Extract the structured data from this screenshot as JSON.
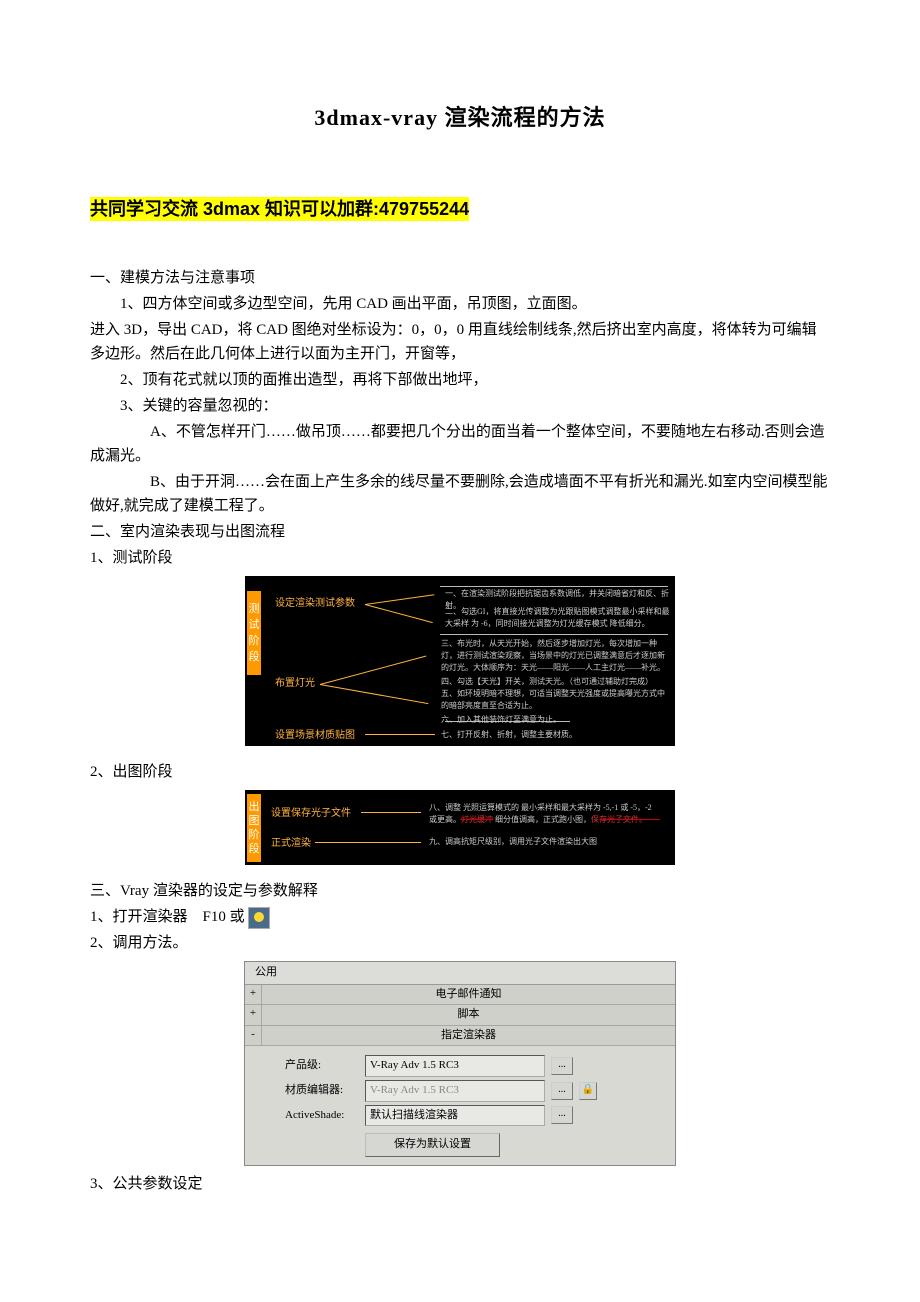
{
  "title": "3dmax-vray 渲染流程的方法",
  "highlight": "共同学习交流 3dmax 知识可以加群:479755244",
  "s1_head": "一、建模方法与注意事项",
  "s1_1": "1、四方体空间或多边型空间，先用 CAD 画出平面，吊顶图，立面图。",
  "s1_body1": "进入 3D，导出 CAD，将 CAD 图绝对坐标设为：0，0，0 用直线绘制线条,然后挤出室内高度，将体转为可编辑多边形。然后在此几何体上进行以面为主开门，开窗等，",
  "s1_2": "2、顶有花式就以顶的面推出造型，再将下部做出地坪，",
  "s1_3": "3、关键的容量忽视的：",
  "s1_3a": "A、不管怎样开门……做吊顶……都要把几个分出的面当着一个整体空间，不要随地左右移动.否则会造成漏光。",
  "s1_3b": "B、由于开洞……会在面上产生多余的线尽量不要删除,会造成墙面不平有折光和漏光.如室内空间模型能做好,就完成了建模工程了。",
  "s2_head": "二、室内渲染表现与出图流程",
  "s2_1": "1、测试阶段",
  "s2_2": "2、出图阶段",
  "s3_head": "三、Vray 渲染器的设定与参数解释",
  "s3_1a": "1、打开渲染器　F10 或",
  "s3_2": "2、调用方法。",
  "s3_3": "3、公共参数设定",
  "diag1": {
    "sidebar": [
      "测",
      "试",
      "阶",
      "段"
    ],
    "left": [
      "设定渲染测试参数",
      "布置灯光",
      "设置场景材质贴图"
    ],
    "right1": "在渲染测试阶段把抗锯齿系数调低，并关闭暗省灯和反、折射。",
    "right2": "勾选GI，将直接光传调整为光跟贴图模式调整最小采样和最大采样 为 -6，同时间接光调整为灯光缓存模式 降低细分。",
    "right3": "布光时，从天光开始，然后逐步增加灯光，每次增加一种灯，进行测试渲染观察，当场景中的灯光已调整满意后才逐加新的灯光。大体顺序为：天光——阳光——人工主灯光——补光。",
    "right4": "勾选【天光】开关，测试天光。（也可通过辅助灯完成）",
    "right5": "如环境明暗不理想，可适当调整天光强度或提高曝光方式中的暗部亮度直至合适为止。",
    "right6": "加入其他装饰灯至满意为止。",
    "right7": "打开反射、折射，调整主要材质。"
  },
  "diag2": {
    "sidebar": [
      "出",
      "图",
      "阶",
      "段"
    ],
    "left": [
      "设置保存光子文件",
      "正式渲染"
    ],
    "right1_a": "调整 光照运算模式的 最小采样和最大采样为 -5,-1 或 -5，-2 或更高。",
    "right1_b": "灯光缓冲",
    "right1_c": " 细分值调高，正式跑小图，",
    "right1_d": "保存光子文件。",
    "right2": "调高抗矩尺级别，调用光子文件渲染出大图"
  },
  "panel": {
    "tab": "公用",
    "bars": [
      {
        "pm": "+",
        "label": "电子邮件通知"
      },
      {
        "pm": "+",
        "label": "脚本"
      },
      {
        "pm": "-",
        "label": "指定渲染器"
      }
    ],
    "rows": [
      {
        "label": "产品级:",
        "value": "V-Ray Adv 1.5 RC3",
        "disabled": false,
        "lock": false
      },
      {
        "label": "材质编辑器:",
        "value": "V-Ray Adv 1.5 RC3",
        "disabled": true,
        "lock": true
      },
      {
        "label": "ActiveShade:",
        "value": "默认扫描线渲染器",
        "disabled": false,
        "lock": false
      }
    ],
    "save": "保存为默认设置"
  }
}
